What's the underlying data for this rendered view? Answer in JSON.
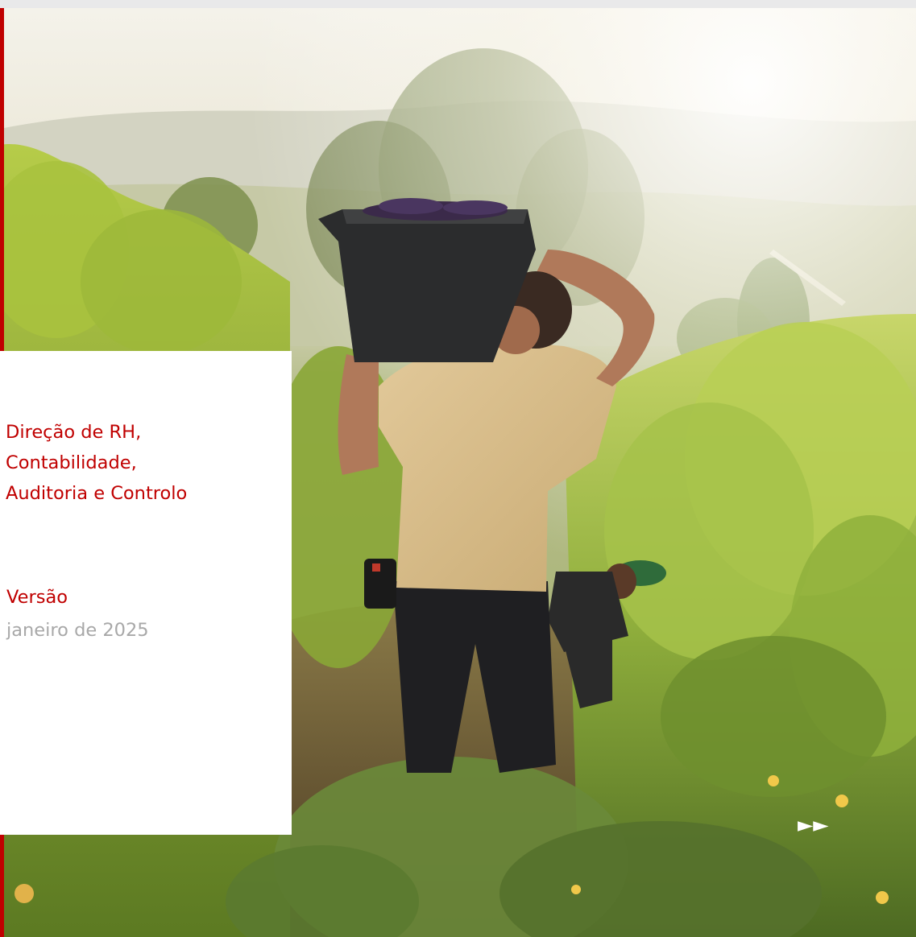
{
  "document": {
    "department_lines": [
      "Direção de RH,",
      "Contabilidade,",
      "Auditoria e Controlo"
    ],
    "version_label": "Versão",
    "version_date": "janeiro de 2025"
  },
  "hero_image": {
    "subject": "vineyard-harvest-photo"
  },
  "navigation": {
    "next_glyph": "►►",
    "icon": "double-play-arrow-icon"
  },
  "colors": {
    "accent": "#c00000",
    "muted_text": "#a8a8a8",
    "panel_background": "#ffffff"
  }
}
